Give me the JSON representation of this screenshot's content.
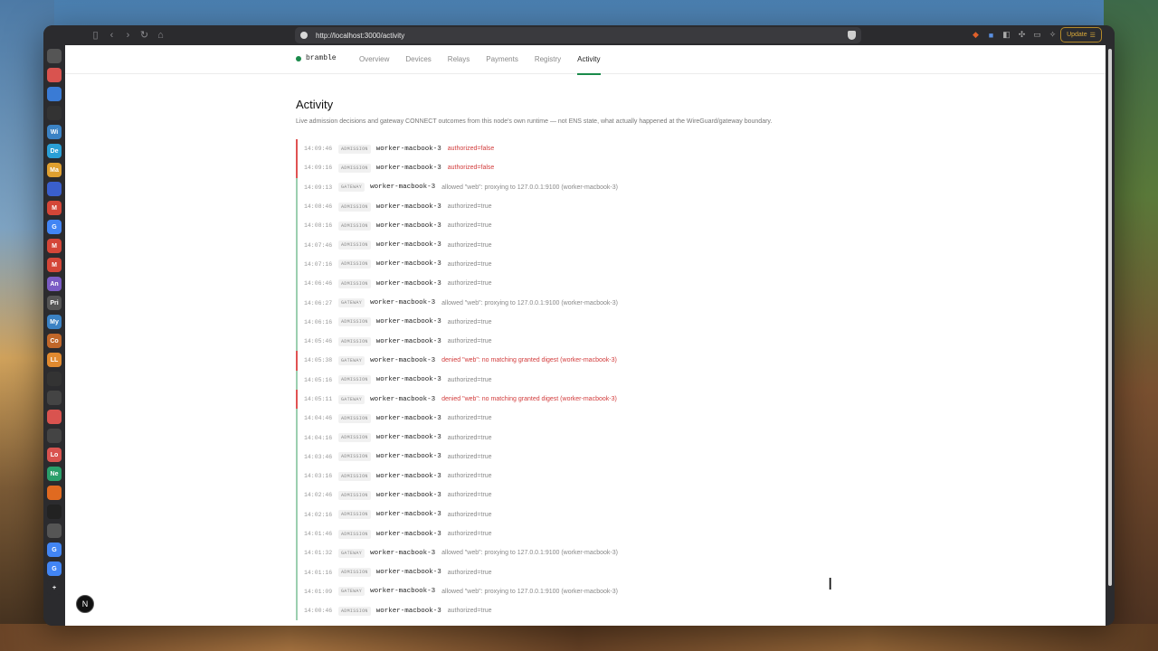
{
  "browser": {
    "url": "http://localhost:3000/activity",
    "update_label": "Update"
  },
  "sidebar": {
    "items": [
      {
        "icon": "settings-icon",
        "label": "",
        "color": "#555555"
      },
      {
        "icon": "spark-icon",
        "label": "",
        "color": "#d9534f"
      },
      {
        "icon": "star-icon",
        "label": "",
        "color": "#3a7bd5"
      },
      {
        "icon": "github-icon",
        "label": "",
        "color": "#333333"
      },
      {
        "icon": "wiki-icon",
        "label": "Wi",
        "color": "#3b82c4"
      },
      {
        "icon": "dev-icon",
        "label": "De",
        "color": "#2a9fd6"
      },
      {
        "icon": "ma-icon",
        "label": "Ma",
        "color": "#e0a030"
      },
      {
        "icon": "globe-icon",
        "label": "",
        "color": "#3a5fcd"
      },
      {
        "icon": "gmail-icon",
        "label": "M",
        "color": "#d44638"
      },
      {
        "icon": "google-icon",
        "label": "G",
        "color": "#4285f4"
      },
      {
        "icon": "gmail-icon",
        "label": "M",
        "color": "#d44638"
      },
      {
        "icon": "gmail-icon",
        "label": "M",
        "color": "#d44638"
      },
      {
        "icon": "an-icon",
        "label": "An",
        "color": "#7a5bc4"
      },
      {
        "icon": "pri-icon",
        "label": "Pri",
        "color": "#555555"
      },
      {
        "icon": "my-icon",
        "label": "My",
        "color": "#3b82c4"
      },
      {
        "icon": "co-icon",
        "label": "Co",
        "color": "#c0672a"
      },
      {
        "icon": "ll-icon",
        "label": "LL",
        "color": "#e08a30"
      },
      {
        "icon": "bird-icon",
        "label": "",
        "color": "#333333"
      },
      {
        "icon": "camera-icon",
        "label": "",
        "color": "#444444"
      },
      {
        "icon": "asterisk-icon",
        "label": "",
        "color": "#d9534f"
      },
      {
        "icon": "chat-icon",
        "label": "",
        "color": "#444444"
      },
      {
        "icon": "lo-icon",
        "label": "Lo",
        "color": "#d9534f"
      },
      {
        "icon": "ne-icon",
        "label": "Ne",
        "color": "#2a9f6a"
      },
      {
        "icon": "hex-icon",
        "label": "",
        "color": "#e06a20"
      },
      {
        "icon": "triangle-icon",
        "label": "",
        "color": "#222222"
      },
      {
        "icon": "clock-icon",
        "label": "",
        "color": "#555555"
      },
      {
        "icon": "google-icon",
        "label": "G",
        "color": "#4285f4"
      },
      {
        "icon": "google-icon",
        "label": "G",
        "color": "#4285f4"
      },
      {
        "icon": "plus-icon",
        "label": "+",
        "color": "#2b2b2e"
      }
    ]
  },
  "app": {
    "brand": "bramble",
    "nav": [
      "Overview",
      "Devices",
      "Relays",
      "Payments",
      "Registry",
      "Activity"
    ],
    "active_nav": "Activity",
    "title": "Activity",
    "subtitle": "Live admission decisions and gateway CONNECT outcomes from this node's own runtime — not ENS state, what actually happened at the WireGuard/gateway boundary.",
    "events": [
      {
        "time": "14:09:46",
        "kind": "ADMISSION",
        "node": "worker-macbook-3",
        "msg": "authorized=false",
        "status": "error"
      },
      {
        "time": "14:09:16",
        "kind": "ADMISSION",
        "node": "worker-macbook-3",
        "msg": "authorized=false",
        "status": "error"
      },
      {
        "time": "14:09:13",
        "kind": "GATEWAY",
        "node": "worker-macbook-3",
        "msg": "allowed \"web\": proxying to 127.0.0.1:9100 (worker-macbook-3)",
        "status": "ok"
      },
      {
        "time": "14:08:46",
        "kind": "ADMISSION",
        "node": "worker-macbook-3",
        "msg": "authorized=true",
        "status": "ok"
      },
      {
        "time": "14:08:16",
        "kind": "ADMISSION",
        "node": "worker-macbook-3",
        "msg": "authorized=true",
        "status": "ok"
      },
      {
        "time": "14:07:46",
        "kind": "ADMISSION",
        "node": "worker-macbook-3",
        "msg": "authorized=true",
        "status": "ok"
      },
      {
        "time": "14:07:16",
        "kind": "ADMISSION",
        "node": "worker-macbook-3",
        "msg": "authorized=true",
        "status": "ok"
      },
      {
        "time": "14:06:46",
        "kind": "ADMISSION",
        "node": "worker-macbook-3",
        "msg": "authorized=true",
        "status": "ok"
      },
      {
        "time": "14:06:27",
        "kind": "GATEWAY",
        "node": "worker-macbook-3",
        "msg": "allowed \"web\": proxying to 127.0.0.1:9100 (worker-macbook-3)",
        "status": "ok"
      },
      {
        "time": "14:06:16",
        "kind": "ADMISSION",
        "node": "worker-macbook-3",
        "msg": "authorized=true",
        "status": "ok"
      },
      {
        "time": "14:05:46",
        "kind": "ADMISSION",
        "node": "worker-macbook-3",
        "msg": "authorized=true",
        "status": "ok"
      },
      {
        "time": "14:05:38",
        "kind": "GATEWAY",
        "node": "worker-macbook-3",
        "msg": "denied \"web\": no matching granted digest (worker-macbook-3)",
        "status": "error"
      },
      {
        "time": "14:05:16",
        "kind": "ADMISSION",
        "node": "worker-macbook-3",
        "msg": "authorized=true",
        "status": "ok"
      },
      {
        "time": "14:05:11",
        "kind": "GATEWAY",
        "node": "worker-macbook-3",
        "msg": "denied \"web\": no matching granted digest (worker-macbook-3)",
        "status": "error"
      },
      {
        "time": "14:04:46",
        "kind": "ADMISSION",
        "node": "worker-macbook-3",
        "msg": "authorized=true",
        "status": "ok"
      },
      {
        "time": "14:04:16",
        "kind": "ADMISSION",
        "node": "worker-macbook-3",
        "msg": "authorized=true",
        "status": "ok"
      },
      {
        "time": "14:03:46",
        "kind": "ADMISSION",
        "node": "worker-macbook-3",
        "msg": "authorized=true",
        "status": "ok"
      },
      {
        "time": "14:03:16",
        "kind": "ADMISSION",
        "node": "worker-macbook-3",
        "msg": "authorized=true",
        "status": "ok"
      },
      {
        "time": "14:02:46",
        "kind": "ADMISSION",
        "node": "worker-macbook-3",
        "msg": "authorized=true",
        "status": "ok"
      },
      {
        "time": "14:02:16",
        "kind": "ADMISSION",
        "node": "worker-macbook-3",
        "msg": "authorized=true",
        "status": "ok"
      },
      {
        "time": "14:01:46",
        "kind": "ADMISSION",
        "node": "worker-macbook-3",
        "msg": "authorized=true",
        "status": "ok"
      },
      {
        "time": "14:01:32",
        "kind": "GATEWAY",
        "node": "worker-macbook-3",
        "msg": "allowed \"web\": proxying to 127.0.0.1:9100 (worker-macbook-3)",
        "status": "ok"
      },
      {
        "time": "14:01:16",
        "kind": "ADMISSION",
        "node": "worker-macbook-3",
        "msg": "authorized=true",
        "status": "ok"
      },
      {
        "time": "14:01:09",
        "kind": "GATEWAY",
        "node": "worker-macbook-3",
        "msg": "allowed \"web\": proxying to 127.0.0.1:9100 (worker-macbook-3)",
        "status": "ok"
      },
      {
        "time": "14:00:46",
        "kind": "ADMISSION",
        "node": "worker-macbook-3",
        "msg": "authorized=true",
        "status": "ok"
      }
    ]
  },
  "dev_badge": "N"
}
